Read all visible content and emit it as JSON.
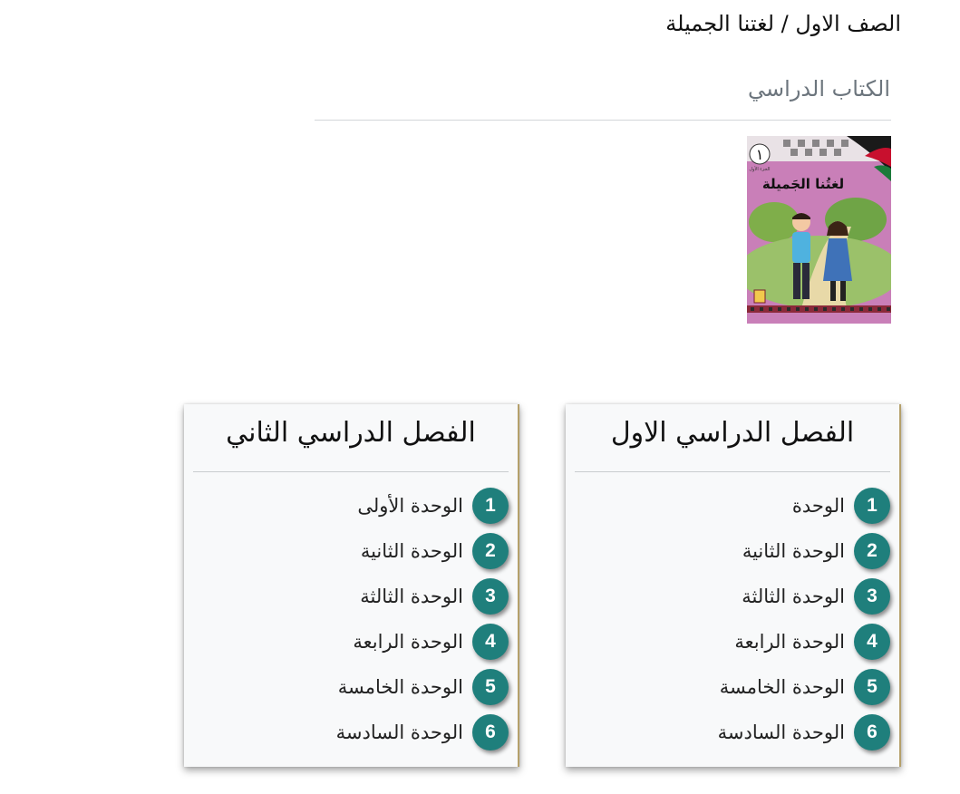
{
  "header": {
    "page_title": "الصف الاول / لغتنا الجميلة",
    "section_title": "الكتاب الدراسي"
  },
  "book": {
    "cover_number": "١",
    "cover_title": "لغتُنا الجَميلة",
    "cover_subtitle": "الجزء الأول",
    "colors": {
      "background": "#c97fb8",
      "band": "#8b2a3a"
    }
  },
  "semesters": [
    {
      "title": "الفصل الدراسي الاول",
      "units": [
        {
          "number": "1",
          "label": "الوحدة"
        },
        {
          "number": "2",
          "label": "الوحدة الثانية"
        },
        {
          "number": "3",
          "label": "الوحدة الثالثة"
        },
        {
          "number": "4",
          "label": "الوحدة الرابعة"
        },
        {
          "number": "5",
          "label": "الوحدة الخامسة"
        },
        {
          "number": "6",
          "label": "الوحدة السادسة"
        }
      ]
    },
    {
      "title": "الفصل الدراسي الثاني",
      "units": [
        {
          "number": "1",
          "label": "الوحدة الأولى"
        },
        {
          "number": "2",
          "label": "الوحدة الثانية"
        },
        {
          "number": "3",
          "label": "الوحدة الثالثة"
        },
        {
          "number": "4",
          "label": "الوحدة الرابعة"
        },
        {
          "number": "5",
          "label": "الوحدة الخامسة"
        },
        {
          "number": "6",
          "label": "الوحدة السادسة"
        }
      ]
    }
  ],
  "theme": {
    "badge_color": "#1f7f7c",
    "card_accent": "#b5a06b"
  }
}
